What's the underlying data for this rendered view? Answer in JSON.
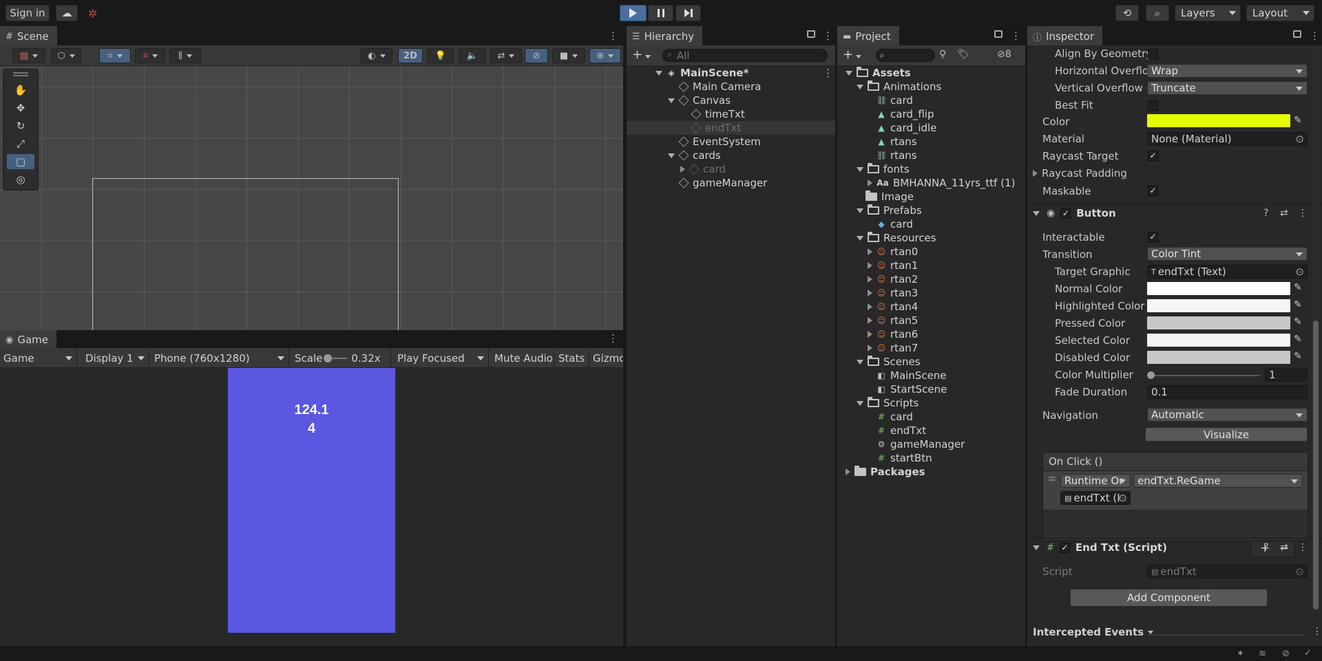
{
  "toolbar": {
    "sign_in": "Sign in",
    "layers": "Layers",
    "layout": "Layout"
  },
  "scene": {
    "tab": "Scene",
    "mode_2d": "2D"
  },
  "game": {
    "tab": "Game",
    "view_select": "Game",
    "display": "Display 1",
    "resolution": "Phone (760x1280)",
    "scale_label": "Scale",
    "scale_value": "0.32x",
    "play_mode": "Play Focused",
    "mute": "Mute Audio",
    "stats": "Stats",
    "gizmos": "Gizmo",
    "timer_line1": "124.1",
    "timer_line2": "4",
    "canvas_color": "#5b57e0"
  },
  "hierarchy": {
    "tab": "Hierarchy",
    "search_placeholder": "All",
    "items": [
      {
        "label": "MainScene*",
        "depth": 0
      },
      {
        "label": "Main Camera",
        "depth": 1
      },
      {
        "label": "Canvas",
        "depth": 1
      },
      {
        "label": "timeTxt",
        "depth": 2
      },
      {
        "label": "endTxt",
        "depth": 2
      },
      {
        "label": "EventSystem",
        "depth": 1
      },
      {
        "label": "cards",
        "depth": 1
      },
      {
        "label": "card",
        "depth": 2
      },
      {
        "label": "gameManager",
        "depth": 1
      }
    ]
  },
  "project": {
    "tab": "Project",
    "hidden_count": "8",
    "items": [
      {
        "label": "Assets",
        "depth": 0
      },
      {
        "label": "Animations",
        "depth": 1
      },
      {
        "label": "card",
        "depth": 2
      },
      {
        "label": "card_flip",
        "depth": 2
      },
      {
        "label": "card_idle",
        "depth": 2
      },
      {
        "label": "rtans",
        "depth": 2
      },
      {
        "label": "rtans",
        "depth": 2
      },
      {
        "label": "fonts",
        "depth": 1
      },
      {
        "label": "BMHANNA_11yrs_ttf (1)",
        "depth": 2
      },
      {
        "label": "Image",
        "depth": 1
      },
      {
        "label": "Prefabs",
        "depth": 1
      },
      {
        "label": "card",
        "depth": 2
      },
      {
        "label": "Resources",
        "depth": 1
      },
      {
        "label": "rtan0",
        "depth": 2
      },
      {
        "label": "rtan1",
        "depth": 2
      },
      {
        "label": "rtan2",
        "depth": 2
      },
      {
        "label": "rtan3",
        "depth": 2
      },
      {
        "label": "rtan4",
        "depth": 2
      },
      {
        "label": "rtan5",
        "depth": 2
      },
      {
        "label": "rtan6",
        "depth": 2
      },
      {
        "label": "rtan7",
        "depth": 2
      },
      {
        "label": "Scenes",
        "depth": 1
      },
      {
        "label": "MainScene",
        "depth": 2
      },
      {
        "label": "StartScene",
        "depth": 2
      },
      {
        "label": "Scripts",
        "depth": 1
      },
      {
        "label": "card",
        "depth": 2
      },
      {
        "label": "endTxt",
        "depth": 2
      },
      {
        "label": "gameManager",
        "depth": 2
      },
      {
        "label": "startBtn",
        "depth": 2
      },
      {
        "label": "Packages",
        "depth": 0
      }
    ]
  },
  "inspector": {
    "tab": "Inspector",
    "text": {
      "align_by_geometry": "Align By Geometry",
      "horizontal_overflow_label": "Horizontal Overflo",
      "horizontal_overflow": "Wrap",
      "vertical_overflow_label": "Vertical Overflow",
      "vertical_overflow": "Truncate",
      "best_fit": "Best Fit",
      "color_label": "Color",
      "color": "#e6ff00",
      "material_label": "Material",
      "material": "None (Material)",
      "raycast_target": "Raycast Target",
      "raycast_padding": "Raycast Padding",
      "maskable": "Maskable"
    },
    "button": {
      "title": "Button",
      "interactable": "Interactable",
      "transition_label": "Transition",
      "transition": "Color Tint",
      "target_graphic_label": "Target Graphic",
      "target_graphic": "endTxt (Text)",
      "normal_color_label": "Normal Color",
      "highlighted_color_label": "Highlighted Color",
      "pressed_color_label": "Pressed Color",
      "selected_color_label": "Selected Color",
      "disabled_color_label": "Disabled Color",
      "color_multiplier_label": "Color Multiplier",
      "color_multiplier": "1",
      "fade_duration_label": "Fade Duration",
      "fade_duration": "0.1",
      "navigation_label": "Navigation",
      "navigation": "Automatic",
      "visualize": "Visualize",
      "on_click": "On Click ()",
      "runtime": "Runtime Or",
      "function": "endTxt.ReGame",
      "object": "endTxt (I"
    },
    "script": {
      "title": "End Txt (Script)",
      "script_label": "Script",
      "script_value": "endTxt"
    },
    "add_component": "Add Component",
    "intercepted_events": "Intercepted Events"
  }
}
